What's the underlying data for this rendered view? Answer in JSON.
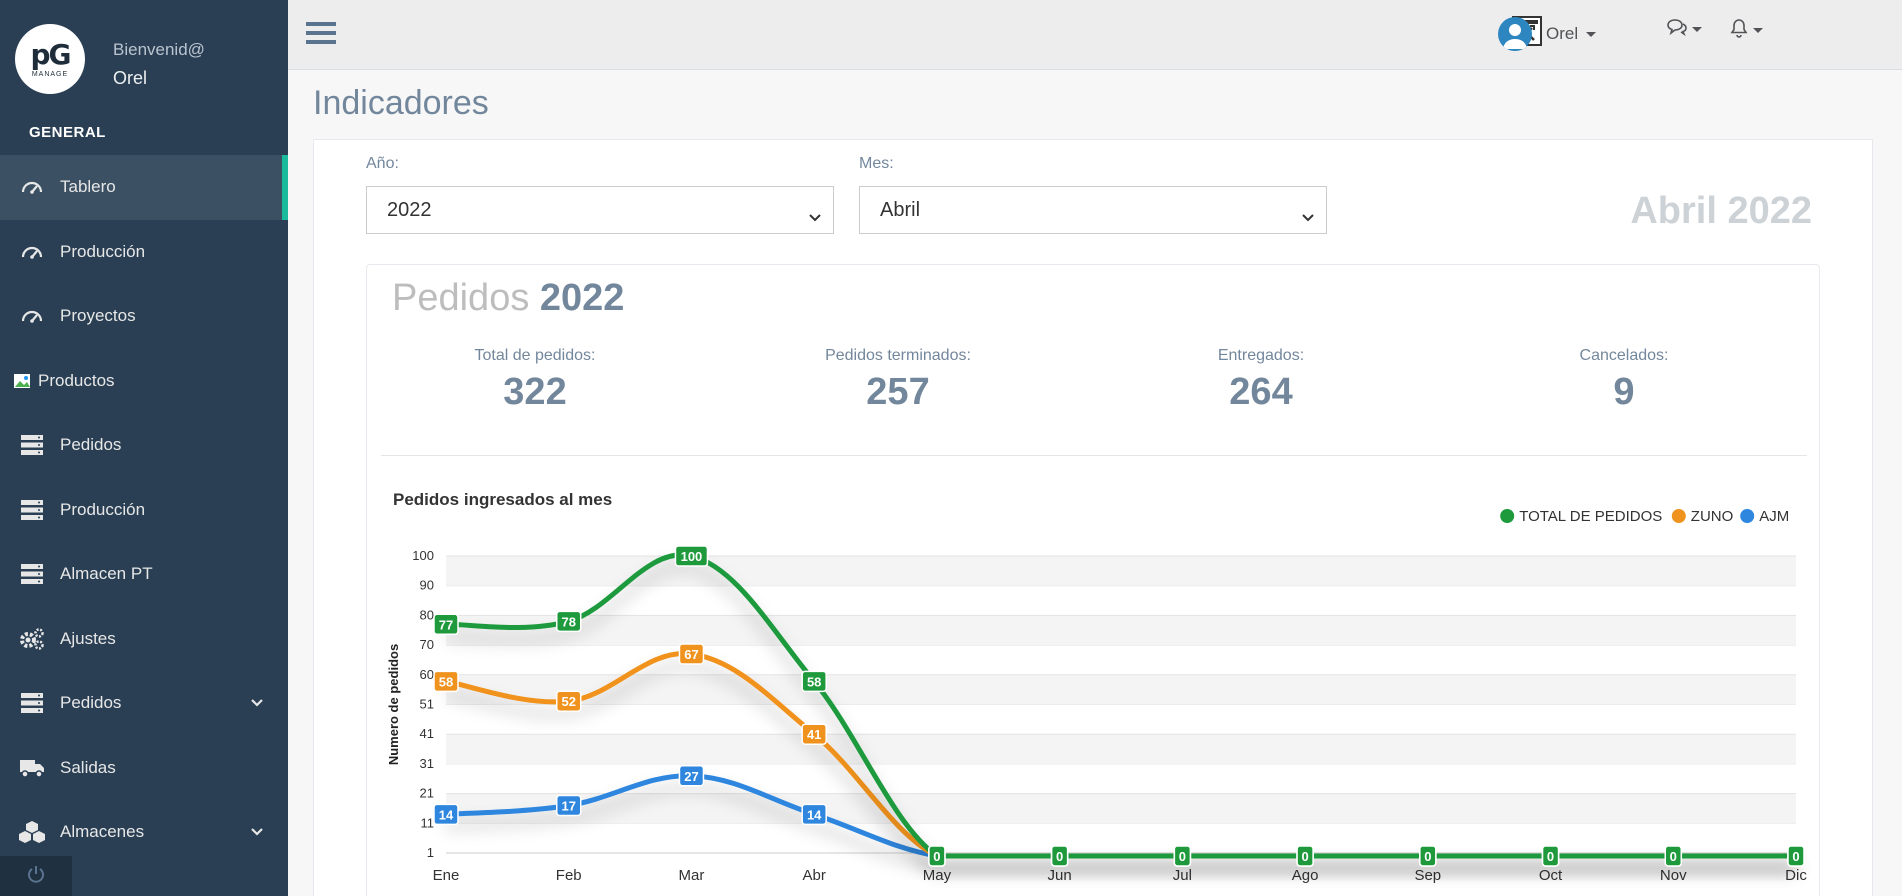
{
  "sidebar": {
    "logo_text": "pG",
    "logo_sub": "MANAGE",
    "welcome": "Bienvenid@",
    "username": "Orel",
    "section_title": "GENERAL",
    "items": [
      {
        "label": "Tablero",
        "icon": "dashboard-gauge-icon"
      },
      {
        "label": "Producción",
        "icon": "dashboard-gauge-icon"
      },
      {
        "label": "Proyectos",
        "icon": "dashboard-gauge-icon"
      },
      {
        "label": "Productos",
        "icon": "broken-image-icon"
      },
      {
        "label": "Pedidos",
        "icon": "server-stack-icon"
      },
      {
        "label": "Producción",
        "icon": "server-stack-icon"
      },
      {
        "label": "Almacen PT",
        "icon": "server-stack-icon"
      },
      {
        "label": "Ajustes",
        "icon": "gears-icon"
      },
      {
        "label": "Pedidos",
        "icon": "server-stack-icon"
      },
      {
        "label": "Salidas",
        "icon": "truck-icon"
      },
      {
        "label": "Almacenes",
        "icon": "cubes-icon"
      }
    ]
  },
  "topbar": {
    "user_name": "Orel"
  },
  "page": {
    "title": "Indicadores",
    "year_label": "Año:",
    "year_value": "2022",
    "month_label": "Mes:",
    "month_value": "Abril",
    "period": "Abril 2022"
  },
  "orders": {
    "title_prefix": "Pedidos",
    "title_year": "2022",
    "stats": [
      {
        "label": "Total de pedidos:",
        "value": "322"
      },
      {
        "label": "Pedidos terminados:",
        "value": "257"
      },
      {
        "label": "Entregados:",
        "value": "264"
      },
      {
        "label": "Cancelados:",
        "value": "9"
      }
    ]
  },
  "chart_data": {
    "type": "line",
    "title": "Pedidos ingresados al mes",
    "ylabel": "Numero de pedidos",
    "categories": [
      "Ene",
      "Feb",
      "Mar",
      "Abr",
      "May",
      "Jun",
      "Jul",
      "Ago",
      "Sep",
      "Oct",
      "Nov",
      "Dic"
    ],
    "yticks": [
      "1",
      "11",
      "21",
      "31",
      "41",
      "51",
      "60",
      "70",
      "80",
      "90",
      "100"
    ],
    "ylim": [
      1,
      100
    ],
    "grid": true,
    "legend_position": "top-right",
    "series": [
      {
        "name": "TOTAL DE PEDIDOS",
        "color": "#1e9a3c",
        "values": [
          77,
          78,
          100,
          58,
          0,
          0,
          0,
          0,
          0,
          0,
          0,
          0
        ]
      },
      {
        "name": "ZUNO",
        "color": "#f0921e",
        "values": [
          58,
          52,
          67,
          41,
          0,
          0,
          0,
          0,
          0,
          0,
          0,
          0
        ]
      },
      {
        "name": "AJM",
        "color": "#2e86de",
        "values": [
          14,
          17,
          27,
          14,
          0,
          0,
          0,
          0,
          0,
          0,
          0,
          0
        ]
      }
    ]
  }
}
